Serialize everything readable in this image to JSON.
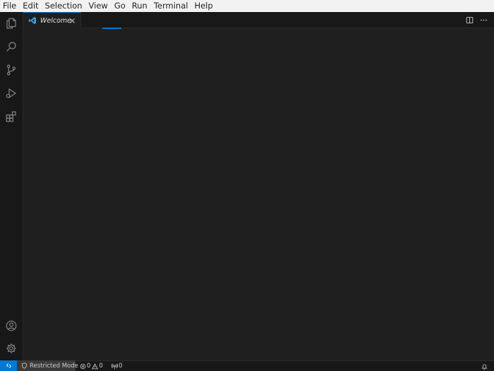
{
  "menu": [
    "File",
    "Edit",
    "Selection",
    "View",
    "Go",
    "Run",
    "Terminal",
    "Help"
  ],
  "activity": {
    "top_icons": [
      "explorer-icon",
      "search-icon",
      "source-control-icon",
      "run-debug-icon",
      "extensions-icon"
    ],
    "bottom_icons": [
      "accounts-icon",
      "manage-gear-icon"
    ]
  },
  "editor": {
    "tabs": [
      {
        "label": "Welcome",
        "icon": "vscode-logo-icon",
        "active": true
      }
    ],
    "actions": [
      "split-editor-icon",
      "more-actions-icon"
    ]
  },
  "statusbar": {
    "remote_icon": "remote-indicator-icon",
    "restricted_label": "Restricted Mode",
    "errors": "0",
    "warnings": "0",
    "ports": "0"
  },
  "colors": {
    "accent": "#0078d4",
    "editor_bg": "#1f1f1f",
    "sidebar_bg": "#181818",
    "menubar_bg": "#f2f2f2"
  }
}
